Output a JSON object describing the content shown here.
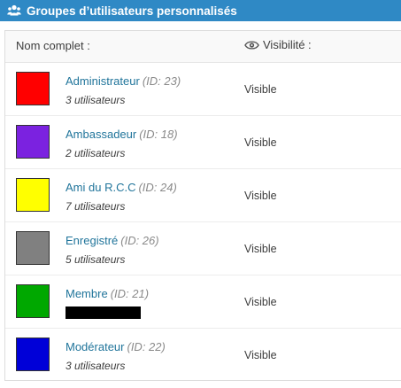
{
  "header": {
    "title": "Groupes d’utilisateurs personnalisés",
    "icon": "users-icon",
    "bg_color": "#2f89c5"
  },
  "table": {
    "columns": {
      "name": "Nom complet :",
      "visibility": "Visibilité :"
    },
    "rows": [
      {
        "color": "#ff0000",
        "name": "Administrateur",
        "id": "(ID: 23)",
        "count": "3 utilisateurs",
        "visibility": "Visible"
      },
      {
        "color": "#7b22e0",
        "name": "Ambassadeur",
        "id": "(ID: 18)",
        "count": "2 utilisateurs",
        "visibility": "Visible"
      },
      {
        "color": "#ffff00",
        "name": "Ami du R.C.C",
        "id": "(ID: 24)",
        "count": "7 utilisateurs",
        "visibility": "Visible"
      },
      {
        "color": "#808080",
        "name": "Enregistré",
        "id": "(ID: 26)",
        "count": "5 utilisateurs",
        "visibility": "Visible"
      },
      {
        "color": "#00a800",
        "name": "Membre",
        "id": "(ID: 21)",
        "count": null,
        "redacted": true,
        "visibility": "Visible"
      },
      {
        "color": "#0000d8",
        "name": "Modérateur",
        "id": "(ID: 22)",
        "count": "3 utilisateurs",
        "visibility": "Visible"
      }
    ]
  }
}
